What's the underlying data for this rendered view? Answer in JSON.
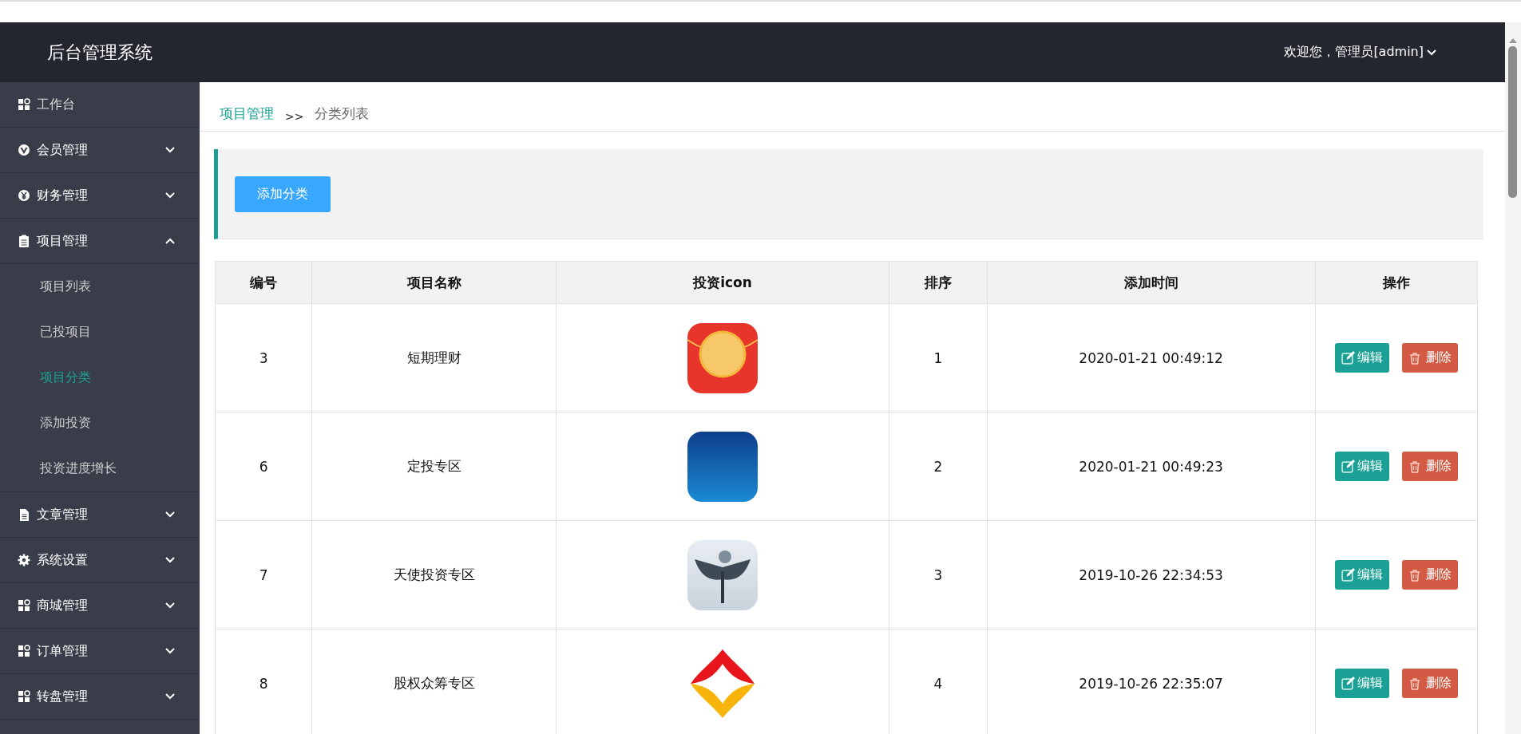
{
  "header": {
    "title": "后台管理系统",
    "user": "欢迎您，管理员[admin]"
  },
  "sidebar": {
    "items": [
      {
        "label": "工作台",
        "kind": "link",
        "selected": false
      },
      {
        "label": "会员管理",
        "kind": "group",
        "expanded": false
      },
      {
        "label": "财务管理",
        "kind": "group",
        "expanded": false
      },
      {
        "label": "项目管理",
        "kind": "group",
        "expanded": true,
        "children": [
          {
            "label": "项目列表",
            "selected": false
          },
          {
            "label": "已投项目",
            "selected": false
          },
          {
            "label": "项目分类",
            "selected": true
          },
          {
            "label": "添加投资",
            "selected": false
          },
          {
            "label": "投资进度增长",
            "selected": false
          }
        ]
      },
      {
        "label": "文章管理",
        "kind": "group",
        "expanded": false
      },
      {
        "label": "系统设置",
        "kind": "group",
        "expanded": false
      },
      {
        "label": "商城管理",
        "kind": "group",
        "expanded": false
      },
      {
        "label": "订单管理",
        "kind": "group",
        "expanded": false
      },
      {
        "label": "转盘管理",
        "kind": "group",
        "expanded": false
      }
    ]
  },
  "breadcrumb": {
    "parent": "项目管理",
    "separator": ">>",
    "current": "分类列表"
  },
  "toolbar": {
    "add_button": "添加分类"
  },
  "table": {
    "columns": [
      "编号",
      "项目名称",
      "投资icon",
      "排序",
      "添加时间",
      "操作"
    ],
    "rows": [
      {
        "id": "3",
        "name": "短期理财",
        "sort": "1",
        "time": "2020-01-21 00:49:12",
        "edit": "编辑",
        "delete": "删除"
      },
      {
        "id": "6",
        "name": "定投专区",
        "sort": "2",
        "time": "2020-01-21 00:49:23",
        "edit": "编辑",
        "delete": "删除"
      },
      {
        "id": "7",
        "name": "天使投资专区",
        "sort": "3",
        "time": "2019-10-26 22:34:53",
        "edit": "编辑",
        "delete": "删除"
      },
      {
        "id": "8",
        "name": "股权众筹专区",
        "sort": "4",
        "time": "2019-10-26 22:35:07",
        "edit": "编辑",
        "delete": "删除"
      }
    ]
  }
}
